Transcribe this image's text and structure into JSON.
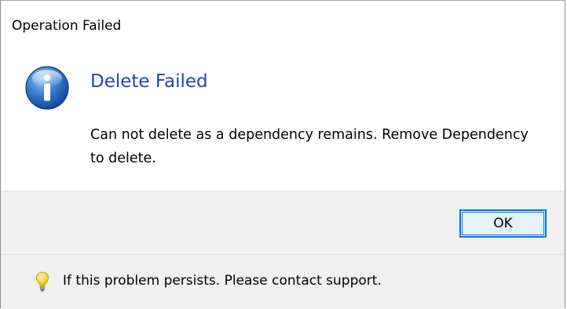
{
  "window": {
    "title": "Operation Failed"
  },
  "content": {
    "icon": "information-icon",
    "main_instruction": "Delete Failed",
    "message": "Can not delete as a dependency remains. Remove Dependency to delete."
  },
  "buttons": {
    "ok_label": "OK"
  },
  "footer": {
    "icon": "lightbulb-icon",
    "text": "If this problem persists. Please contact support."
  },
  "colors": {
    "instruction_text": "#1f48a8",
    "button_border": "#0078d7",
    "button_fill": "#e5f1fb",
    "panel_background": "#f0f0f0"
  }
}
